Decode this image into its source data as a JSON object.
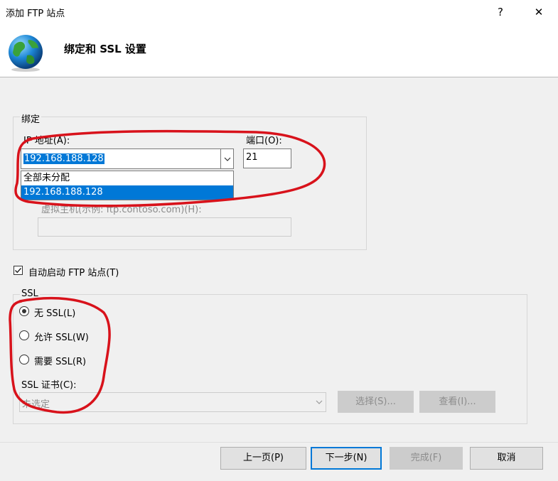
{
  "window": {
    "title": "添加 FTP 站点",
    "help": "?",
    "close": "✕"
  },
  "header": {
    "title": "绑定和 SSL 设置"
  },
  "binding": {
    "group_label": "绑定",
    "ip_label": "IP 地址(A):",
    "ip_value": "192.168.188.128",
    "dropdown_options": [
      "全部未分配",
      "192.168.188.128"
    ],
    "port_label": "端口(O):",
    "port_value": "21",
    "virtual_host_label": "虚拟主机(示例: ftp.contoso.com)(H):",
    "virtual_host_value": ""
  },
  "autostart": {
    "label": "自动启动 FTP 站点(T)",
    "checked": true
  },
  "ssl": {
    "group_label": "SSL",
    "options": [
      "无 SSL(L)",
      "允许 SSL(W)",
      "需要 SSL(R)"
    ],
    "selected": 0,
    "cert_label": "SSL 证书(C):",
    "cert_value": "未选定",
    "select_button": "选择(S)...",
    "view_button": "查看(I)..."
  },
  "footer": {
    "prev": "上一页(P)",
    "next": "下一步(N)",
    "finish": "完成(F)",
    "cancel": "取消"
  },
  "colors": {
    "accent": "#0078d7",
    "annotation": "#d8121b"
  }
}
